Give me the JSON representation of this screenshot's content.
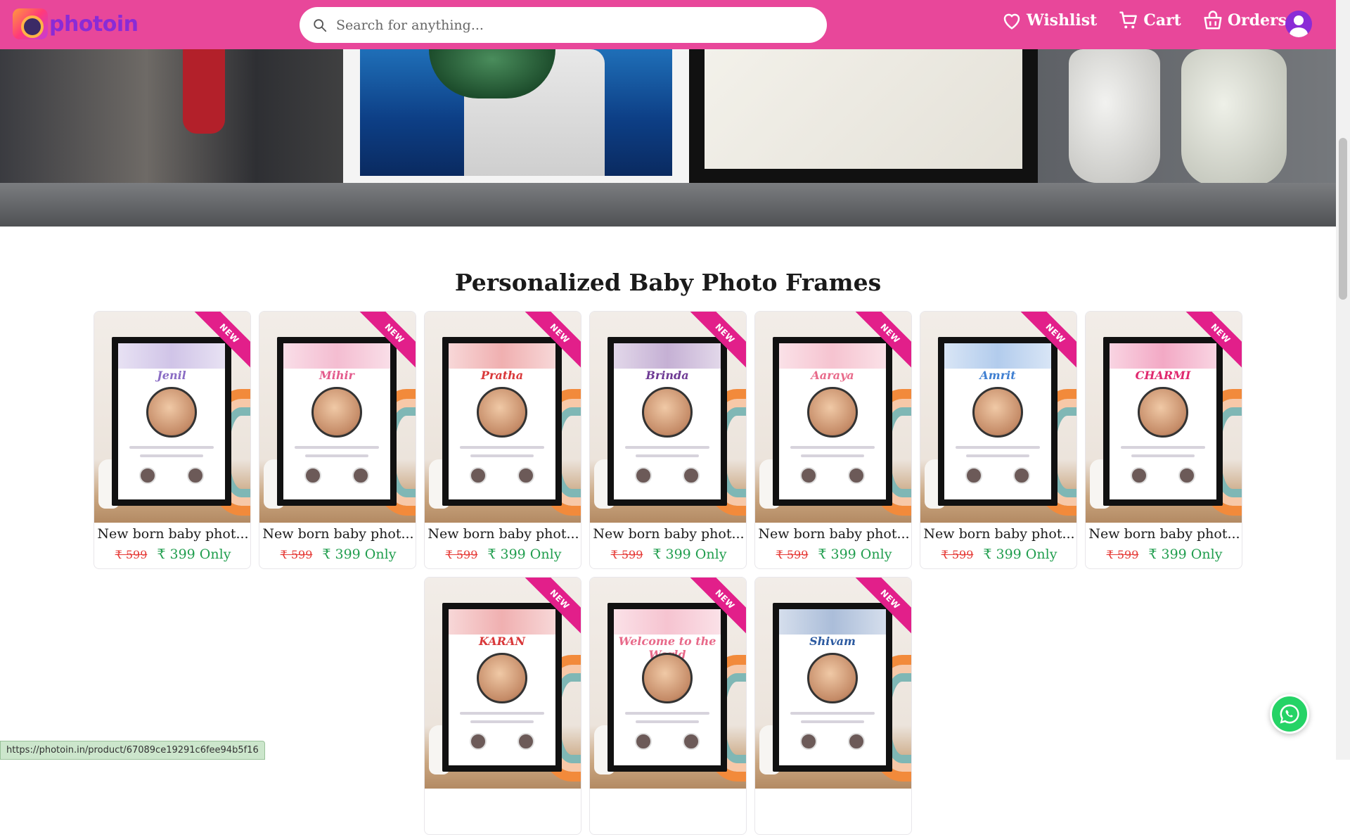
{
  "header": {
    "logo_text": "photoin",
    "search_placeholder": "Search for anything...",
    "nav": [
      {
        "label": "Wishlist",
        "icon": "heart-icon"
      },
      {
        "label": "Cart",
        "icon": "cart-icon"
      },
      {
        "label": "Orders",
        "icon": "orders-icon"
      }
    ]
  },
  "section": {
    "title": "Personalized Baby Photo Frames"
  },
  "products": [
    {
      "name": "New born baby phot...",
      "old_price": "₹ 599",
      "price": "₹ 399 Only",
      "badge": "NEW",
      "frame_name": "Jenil",
      "accent": "#8a6cc4"
    },
    {
      "name": "New born baby phot...",
      "old_price": "₹ 599",
      "price": "₹ 399 Only",
      "badge": "NEW",
      "frame_name": "Mihir",
      "accent": "#e35a8c"
    },
    {
      "name": "New born baby phot...",
      "old_price": "₹ 599",
      "price": "₹ 399 Only",
      "badge": "NEW",
      "frame_name": "Pratha",
      "accent": "#d9383a"
    },
    {
      "name": "New born baby phot...",
      "old_price": "₹ 599",
      "price": "₹ 399 Only",
      "badge": "NEW",
      "frame_name": "Brinda",
      "accent": "#6e3a94"
    },
    {
      "name": "New born baby phot...",
      "old_price": "₹ 599",
      "price": "₹ 399 Only",
      "badge": "NEW",
      "frame_name": "Aaraya",
      "accent": "#e86a8a"
    },
    {
      "name": "New born baby phot...",
      "old_price": "₹ 599",
      "price": "₹ 399 Only",
      "badge": "NEW",
      "frame_name": "Amrit",
      "accent": "#3f7fd1"
    },
    {
      "name": "New born baby phot...",
      "old_price": "₹ 599",
      "price": "₹ 399 Only",
      "badge": "NEW",
      "frame_name": "CHARMI",
      "accent": "#e0286e"
    },
    {
      "badge": "NEW",
      "frame_name": "KARAN",
      "accent": "#d9383a"
    },
    {
      "badge": "NEW",
      "frame_name": "Welcome to the World",
      "accent": "#e86a8a"
    },
    {
      "badge": "NEW",
      "frame_name": "Shivam",
      "accent": "#2c5aa0"
    }
  ],
  "status_url": "https://photoin.in/product/67089ce19291c6fee94b5f16",
  "colors": {
    "header_bg": "#e8479a",
    "ribbon": "#e21f8a",
    "old_price": "#e53935",
    "new_price": "#1f9d4d",
    "whatsapp": "#25d366"
  }
}
